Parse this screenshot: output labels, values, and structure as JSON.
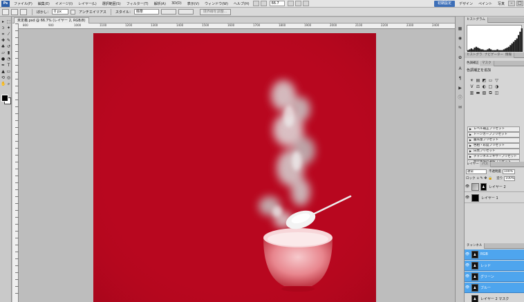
{
  "menubar": {
    "logo": "Ps",
    "items": [
      "ファイル(F)",
      "編集(E)",
      "イメージ(I)",
      "レイヤー(L)",
      "選択範囲(S)",
      "フィルター(T)",
      "解析(A)",
      "3D(D)",
      "表示(V)",
      "ウィンドウ(W)",
      "ヘルプ(H)"
    ],
    "zoom": "66.7",
    "workspace": "初期設定",
    "workspace_items": [
      "デザイン",
      "ペイント",
      "写真"
    ]
  },
  "options": {
    "feather_label": "ぼかし：",
    "feather_value": "0 px",
    "antialias_label": "アンチエイリアス",
    "style_label": "スタイル：",
    "style_value": "標準",
    "refine_button": "境界線を調整..."
  },
  "document": {
    "tab_title": "未定義.psd @ 66.7% (レイヤー 2, RGB/8)",
    "ruler_marks": [
      "800",
      "900",
      "1000",
      "1100",
      "1200",
      "1300",
      "1400",
      "1500",
      "1600",
      "1700",
      "1800",
      "1900",
      "2000",
      "2100",
      "2200",
      "2300",
      "2400"
    ]
  },
  "histogram": {
    "tabs": [
      "ヒストグラム",
      "ナビゲーター",
      "情報"
    ],
    "bins": [
      2,
      3,
      4,
      3,
      5,
      6,
      5,
      4,
      3,
      3,
      2,
      2,
      3,
      4,
      3,
      2,
      2,
      2,
      3,
      2,
      2,
      2,
      3,
      4,
      5,
      6,
      8,
      10,
      12,
      14,
      16,
      20,
      24,
      28
    ]
  },
  "adjustments": {
    "tabs": [
      "色調補正",
      "マスク"
    ],
    "caption": "色調補正を追加",
    "icons": [
      "☀",
      "▤",
      "◩",
      "▭",
      "▽",
      "V",
      "⚖",
      "◐",
      "□",
      "◑",
      "▥",
      "▬",
      "▧",
      "⧉",
      "◫"
    ],
    "presets": [
      "レベル補正プリセット",
      "トーンカーブプリセット",
      "露光量プリセット",
      "色相・彩度プリセット",
      "白黒プリセット",
      "チャンネルミキサープリセット",
      "特定色域の選択プリセット"
    ]
  },
  "layers": {
    "tabs": [
      "レイヤー",
      "パス"
    ],
    "blend_mode": "通常",
    "opacity_label": "不透明度",
    "opacity": "100%",
    "lock_label": "ロック",
    "fill_label": "塗り",
    "fill": "100%",
    "items": [
      {
        "name": "レイヤー 2",
        "selected": true
      },
      {
        "name": "レイヤー 1",
        "selected": false
      }
    ]
  },
  "channels": {
    "tab": "チャンネル",
    "items": [
      "RGB",
      "レッド",
      "グリーン",
      "ブルー",
      "レイヤー 2 マスク"
    ]
  },
  "colors": {
    "canvas": "#b8071f",
    "selection": "#3d8fe0"
  }
}
